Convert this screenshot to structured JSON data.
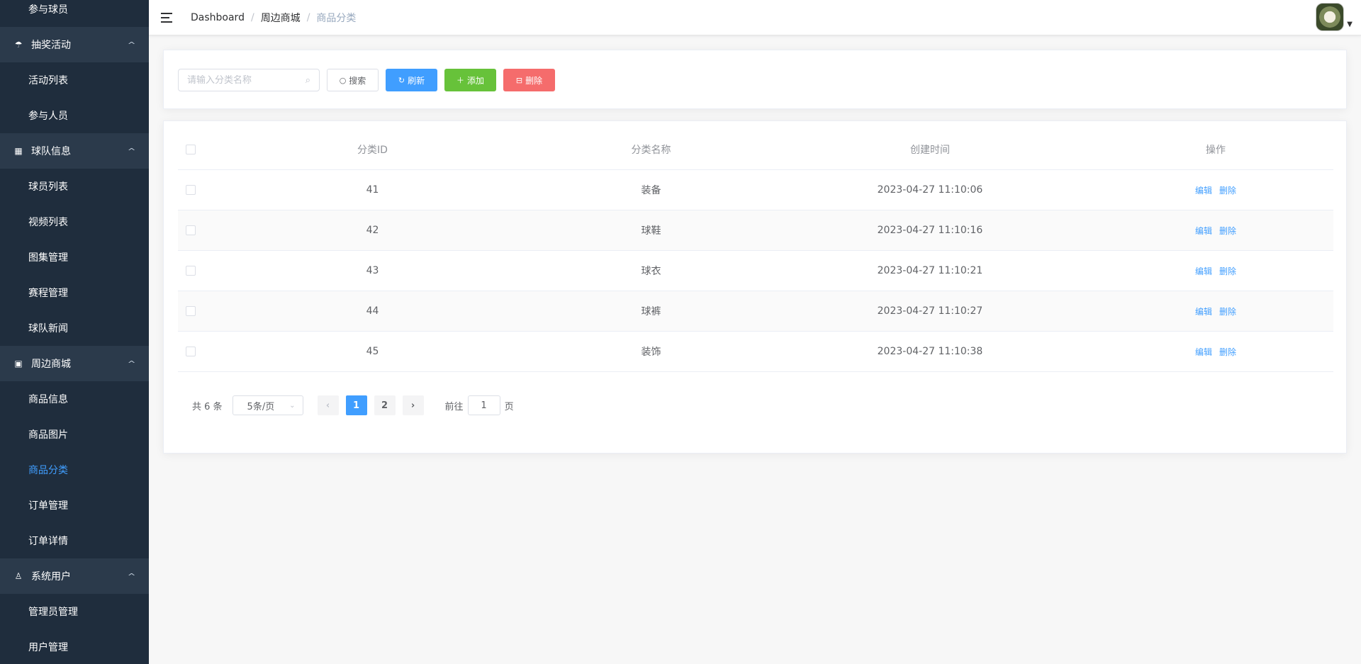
{
  "sidebar": {
    "items": [
      {
        "type": "item",
        "label": "参与球员"
      },
      {
        "type": "group",
        "label": "抽奖活动",
        "icon": "umbrella-icon"
      },
      {
        "type": "item",
        "label": "活动列表"
      },
      {
        "type": "item",
        "label": "参与人员"
      },
      {
        "type": "group",
        "label": "球队信息",
        "icon": "building-icon"
      },
      {
        "type": "item",
        "label": "球员列表"
      },
      {
        "type": "item",
        "label": "视频列表"
      },
      {
        "type": "item",
        "label": "图集管理"
      },
      {
        "type": "item",
        "label": "赛程管理"
      },
      {
        "type": "item",
        "label": "球队新闻"
      },
      {
        "type": "group",
        "label": "周边商城",
        "icon": "shop-icon"
      },
      {
        "type": "item",
        "label": "商品信息"
      },
      {
        "type": "item",
        "label": "商品图片"
      },
      {
        "type": "item",
        "label": "商品分类",
        "active": true
      },
      {
        "type": "item",
        "label": "订单管理"
      },
      {
        "type": "item",
        "label": "订单详情"
      },
      {
        "type": "group",
        "label": "系统用户",
        "icon": "user-icon"
      },
      {
        "type": "item",
        "label": "管理员管理"
      },
      {
        "type": "item",
        "label": "用户管理"
      }
    ]
  },
  "header": {
    "breadcrumb": [
      "Dashboard",
      "周边商城",
      "商品分类"
    ]
  },
  "search": {
    "placeholder": "请输入分类名称",
    "value": "",
    "search_label": "搜索",
    "refresh_label": "刷新",
    "add_label": "添加",
    "delete_label": "删除"
  },
  "table": {
    "columns": [
      "分类ID",
      "分类名称",
      "创建时间",
      "操作"
    ],
    "rows": [
      {
        "id": "41",
        "name": "装备",
        "time": "2023-04-27 11:10:06"
      },
      {
        "id": "42",
        "name": "球鞋",
        "time": "2023-04-27 11:10:16"
      },
      {
        "id": "43",
        "name": "球衣",
        "time": "2023-04-27 11:10:21"
      },
      {
        "id": "44",
        "name": "球裤",
        "time": "2023-04-27 11:10:27"
      },
      {
        "id": "45",
        "name": "装饰",
        "time": "2023-04-27 11:10:38"
      }
    ],
    "edit_label": "编辑",
    "delete_label": "删除"
  },
  "pagination": {
    "total_text": "共 6 条",
    "page_size": "5条/页",
    "pages": [
      "1",
      "2"
    ],
    "current": "1",
    "goto_prefix": "前往",
    "goto_value": "1",
    "goto_suffix": "页"
  },
  "colors": {
    "primary": "#409eff",
    "success": "#67c23a",
    "danger": "#f56c6c",
    "sidebar_bg": "#1f2d3d"
  }
}
